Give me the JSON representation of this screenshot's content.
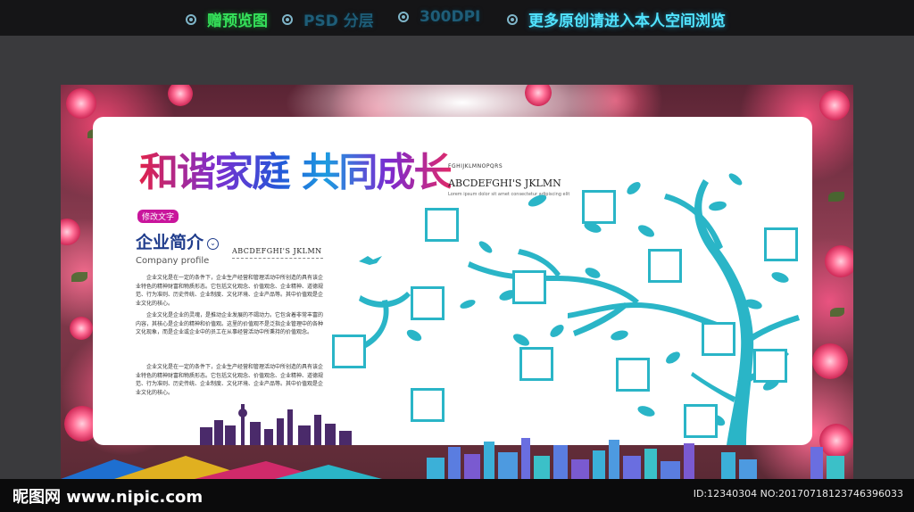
{
  "topbar": {
    "items": [
      {
        "label": "赠预览图",
        "style": "green"
      },
      {
        "label": "PSD 分层",
        "style": "dim"
      },
      {
        "label": "300DPI",
        "style": "dim"
      },
      {
        "label": "更多原创请进入本人空间浏览",
        "style": "cyan"
      }
    ]
  },
  "board": {
    "title": "和谐家庭 共同成长",
    "subtitle_badge": "修改文字",
    "section_title": "企业简介",
    "section_icon": "chevron-down-icon",
    "section_en": "Company profile",
    "section_abc": "ABCDEFGHI'S  JKLMN",
    "paragraphs": [
      "企业文化是在一定的条件下，企业生产经营和管理活动中所创造的具有该企业特色的精神财富和物质形态。它包括文化观念、价值观念、企业精神、道德规范、行为准则、历史传统、企业制度、文化环境、企业产品等。其中价值观是企业文化的核心。",
      "企业文化是企业的灵魂，是推动企业发展的不竭动力。它包含着非常丰富的内容，其核心是企业的精神和价值观。这里的价值观不是泛指企业管理中的各种文化现象，而是企业或企业中的员工在从事经营活动中所秉持的价值观念。",
      "企业文化是在一定的条件下，企业生产经营和管理活动中所创造的具有该企业特色的精神财富和物质形态。它包括文化观念、价值观念、企业精神、道德规范、行为准则、历史传统、企业制度、文化环境、企业产品等。其中价值观是企业文化的核心。"
    ],
    "right_small": "FGHIJKLMNOPQRS",
    "right_abc": "ABCDEFGHI'S  JKLMN",
    "right_tiny": "Lorem ipsum dolor sit amet consectetur adipiscing elit",
    "colors": {
      "tree": "#2ab5c7",
      "title_blue": "#203d8c",
      "badge": "#c9159c"
    }
  },
  "footer": {
    "logo": "昵图网 www.nipic.com",
    "id_text": "ID:12340304 NO:20170718123746396033"
  }
}
